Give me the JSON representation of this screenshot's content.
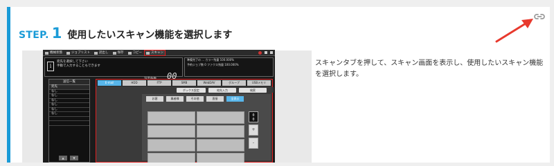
{
  "step": {
    "label": "STEP.",
    "number": "1",
    "title": "使用したいスキャン機能を選択します"
  },
  "description": "スキャンタブを押して、スキャン画面を表示し、使用したいスキャン機能を選択します。",
  "colors": {
    "accent": "#1a9bd7",
    "arrow": "#e8392d",
    "highlight": "#e02020"
  },
  "icons": {
    "link": "link-icon",
    "arrow": "red-arrow-icon"
  },
  "screen": {
    "top_tabs": [
      "機械状態",
      "ジョブリスト",
      "読出し",
      "保存",
      "コピー",
      "スキャン"
    ],
    "message": [
      "宛先を選択して下さい",
      "手動で入力することもできます"
    ],
    "setting_label": "設定件数",
    "count": "00",
    "info": [
      "準備完了の ...  カラー残量  100.000%",
      "予約ジョブ数  0   ファクス残量 100.000%"
    ],
    "left_title": "送信一覧",
    "left_header": "宛先",
    "left_items": [
      "なし",
      "なし",
      "なし",
      "なし",
      "なし",
      "なし"
    ],
    "tabs": [
      "E-mail",
      "HDD",
      "FTP",
      "SMB",
      "WebDAV",
      "グループ",
      "USBメモリ"
    ],
    "row2": [
      "ボックス設定",
      "宛先入力",
      "検索"
    ],
    "subtabs": [
      "お客",
      "業者様",
      "その他",
      "直接",
      "全表示"
    ],
    "side_display": [
      "0",
      "0"
    ],
    "side_up": "+",
    "side_down": "-"
  }
}
